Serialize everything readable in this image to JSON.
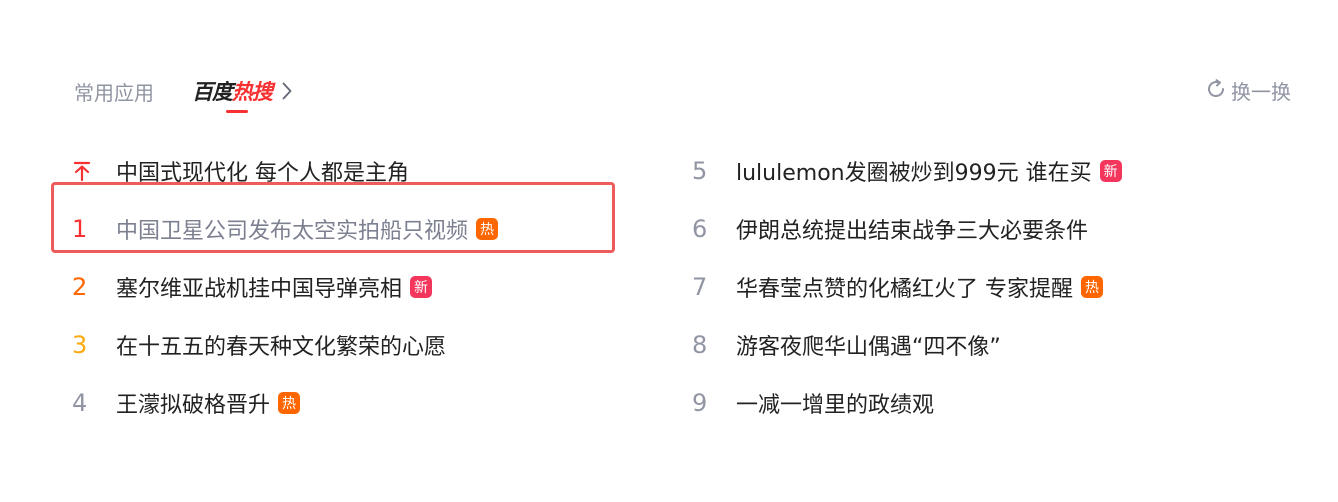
{
  "tabs": {
    "common_label": "常用应用",
    "hot_label_part1": "百度",
    "hot_label_part2": "热搜",
    "chevron_icon": "chevron-right-icon"
  },
  "refresh": {
    "label": "换一换",
    "icon": "refresh-icon"
  },
  "colors": {
    "accent": "#f73131",
    "rank1": "#f73131",
    "rank2": "#ff6600",
    "rank3": "#faa90e",
    "rank_other": "#9195a3",
    "badge_hot": "#ff6600",
    "badge_new": "#f5365c",
    "highlight_box": "#ef5a5a"
  },
  "hot_list": {
    "left": [
      {
        "rank": "",
        "title": "中国式现代化 每个人都是主角",
        "badge": "",
        "rank_icon": "pinned-top-icon"
      },
      {
        "rank": "1",
        "title": "中国卫星公司发布太空实拍船只视频",
        "badge": "热"
      },
      {
        "rank": "2",
        "title": "塞尔维亚战机挂中国导弹亮相",
        "badge": "新"
      },
      {
        "rank": "3",
        "title": "在十五五的春天种文化繁荣的心愿",
        "badge": ""
      },
      {
        "rank": "4",
        "title": "王濛拟破格晋升",
        "badge": "热"
      }
    ],
    "right": [
      {
        "rank": "5",
        "title": "lululemon发圈被炒到999元 谁在买",
        "badge": "新"
      },
      {
        "rank": "6",
        "title": "伊朗总统提出结束战争三大必要条件",
        "badge": ""
      },
      {
        "rank": "7",
        "title": "华春莹点赞的化橘红火了 专家提醒",
        "badge": "热"
      },
      {
        "rank": "8",
        "title": "游客夜爬华山偶遇“四不像”",
        "badge": ""
      },
      {
        "rank": "9",
        "title": "一减一增里的政绩观",
        "badge": ""
      }
    ]
  }
}
